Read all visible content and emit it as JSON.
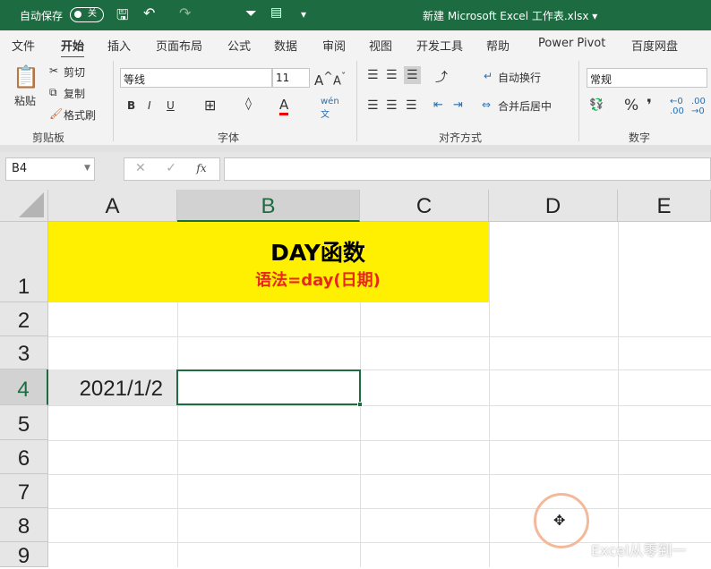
{
  "titlebar": {
    "autosave": "自动保存",
    "toggle": "关",
    "filename": "新建 Microsoft Excel 工作表.xlsx ▾"
  },
  "tabs": [
    "文件",
    "开始",
    "插入",
    "页面布局",
    "公式",
    "数据",
    "审阅",
    "视图",
    "开发工具",
    "帮助",
    "Power Pivot",
    "百度网盘"
  ],
  "ribbon": {
    "paste": "粘贴",
    "cut": "剪切",
    "copy": "复制",
    "format_painter": "格式刷",
    "clipboard_group": "剪贴板",
    "font_name": "等线",
    "font_size": "11",
    "bold": "B",
    "italic": "I",
    "underline": "U",
    "font_group": "字体",
    "wrap_text": "自动换行",
    "merge_center": "合并后居中",
    "align_group": "对齐方式",
    "number_format": "常规",
    "percent": "%",
    "comma": "❜",
    "number_group": "数字"
  },
  "formula_bar": {
    "name_box": "B4",
    "cancel": "✕",
    "enter": "✓",
    "fx": "fx",
    "formula": ""
  },
  "columns": [
    "A",
    "B",
    "C",
    "D",
    "E"
  ],
  "rows": [
    "1",
    "2",
    "3",
    "4",
    "5",
    "6",
    "7",
    "8",
    "9"
  ],
  "cells": {
    "title": "DAY函数",
    "syntax": "语法=day(日期)",
    "A4": "2021/1/2"
  },
  "watermark": "Excel从零到一",
  "colors": {
    "green": "#1d6b40",
    "yellow": "#ffef00",
    "red": "#e8261c"
  }
}
